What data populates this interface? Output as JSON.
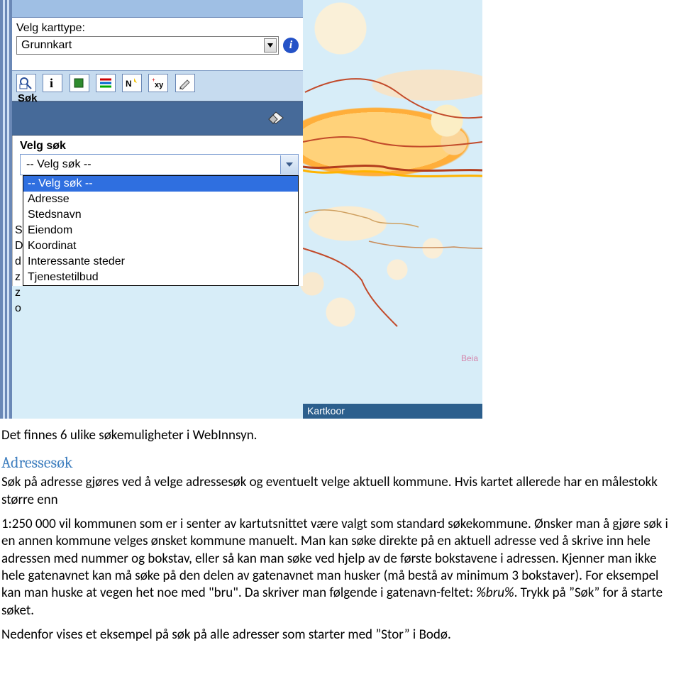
{
  "screenshot": {
    "maptype_label": "Velg karttype:",
    "maptype_value": "Grunnkart",
    "toolbar_icons": [
      "search-zoom-icon",
      "info-icon",
      "legend-square-icon",
      "legend-lines-icon",
      "north-icon",
      "xy-icon",
      "pencil-icon"
    ],
    "sok_label": "Søk",
    "velg_sok_label": "Velg søk",
    "select_value": "-- Velg søk --",
    "dropdown_options": [
      "-- Velg søk --",
      "Adresse",
      "Stedsnavn",
      "Eiendom",
      "Koordinat",
      "Interessante steder",
      "Tjenestetilbud"
    ],
    "margin_letters": [
      "S",
      "D",
      "d",
      "z",
      "z",
      "o"
    ],
    "map_label": "Beia",
    "bottom_bar": "Kartkoor"
  },
  "doc": {
    "p_intro": "Det finnes 6 ulike søkemuligheter i WebInnsyn.",
    "h_adressesok": "Adressesøk",
    "p_adr_1": "Søk på adresse gjøres ved å velge adressesøk og eventuelt velge aktuell kommune. Hvis kartet allerede har en målestokk større enn",
    "p_adr_2a": " 1:250 000 vil kommunen som er i senter av kartutsnittet være valgt som standard søkekommune. Ønsker man å gjøre søk i en annen kommune velges ønsket kommune manuelt. Man kan søke direkte på en aktuell adresse ved å skrive inn hele adressen med nummer og bokstav, eller så kan man søke ved hjelp av de første bokstavene i adressen. Kjenner man ikke hele gatenavnet kan må søke på den delen av gatenavnet man husker (må bestå av minimum 3 bokstaver). For eksempel kan man huske at vegen het noe med \"bru\". Da skriver man følgende i gatenavn-feltet: ",
    "p_adr_2b": "%bru%",
    "p_adr_2c": ". Trykk på ”Søk” for å starte søket.",
    "p_neden": "Nedenfor vises et eksempel på søk på alle adresser som starter med ”Stor” i Bodø."
  }
}
